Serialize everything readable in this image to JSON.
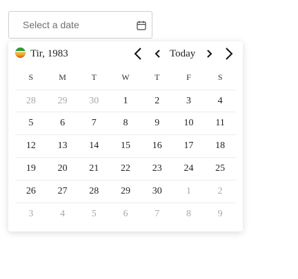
{
  "date_input": {
    "placeholder": "Select a date",
    "value": ""
  },
  "calendar": {
    "month_year": "Tir, 1983",
    "today_label": "Today",
    "weekdays": [
      "S",
      "M",
      "T",
      "W",
      "T",
      "F",
      "S"
    ],
    "weeks": [
      [
        {
          "d": "28",
          "m": true
        },
        {
          "d": "29",
          "m": true
        },
        {
          "d": "30",
          "m": true
        },
        {
          "d": "1",
          "m": false
        },
        {
          "d": "2",
          "m": false
        },
        {
          "d": "3",
          "m": false
        },
        {
          "d": "4",
          "m": false
        }
      ],
      [
        {
          "d": "5",
          "m": false
        },
        {
          "d": "6",
          "m": false
        },
        {
          "d": "7",
          "m": false
        },
        {
          "d": "8",
          "m": false
        },
        {
          "d": "9",
          "m": false
        },
        {
          "d": "10",
          "m": false
        },
        {
          "d": "11",
          "m": false
        }
      ],
      [
        {
          "d": "12",
          "m": false
        },
        {
          "d": "13",
          "m": false
        },
        {
          "d": "14",
          "m": false
        },
        {
          "d": "15",
          "m": false
        },
        {
          "d": "16",
          "m": false
        },
        {
          "d": "17",
          "m": false
        },
        {
          "d": "18",
          "m": false
        }
      ],
      [
        {
          "d": "19",
          "m": false
        },
        {
          "d": "20",
          "m": false
        },
        {
          "d": "21",
          "m": false
        },
        {
          "d": "22",
          "m": false
        },
        {
          "d": "23",
          "m": false
        },
        {
          "d": "24",
          "m": false
        },
        {
          "d": "25",
          "m": false
        }
      ],
      [
        {
          "d": "26",
          "m": false
        },
        {
          "d": "27",
          "m": false
        },
        {
          "d": "28",
          "m": false
        },
        {
          "d": "29",
          "m": false
        },
        {
          "d": "30",
          "m": false
        },
        {
          "d": "1",
          "m": true
        },
        {
          "d": "2",
          "m": true
        }
      ],
      [
        {
          "d": "3",
          "m": true
        },
        {
          "d": "4",
          "m": true
        },
        {
          "d": "5",
          "m": true
        },
        {
          "d": "6",
          "m": true
        },
        {
          "d": "7",
          "m": true
        },
        {
          "d": "8",
          "m": true
        },
        {
          "d": "9",
          "m": true
        }
      ]
    ]
  },
  "icons": {
    "calendar": "calendar-icon",
    "flag": "iran-flag-icon",
    "prev_year": "chevron-left-large-icon",
    "prev_month": "chevron-left-small-icon",
    "next_month": "chevron-right-small-icon",
    "next_year": "chevron-right-large-icon"
  },
  "colors": {
    "muted_day": "#a8a8a8",
    "text": "#222222",
    "border": "#cfcfcf"
  }
}
